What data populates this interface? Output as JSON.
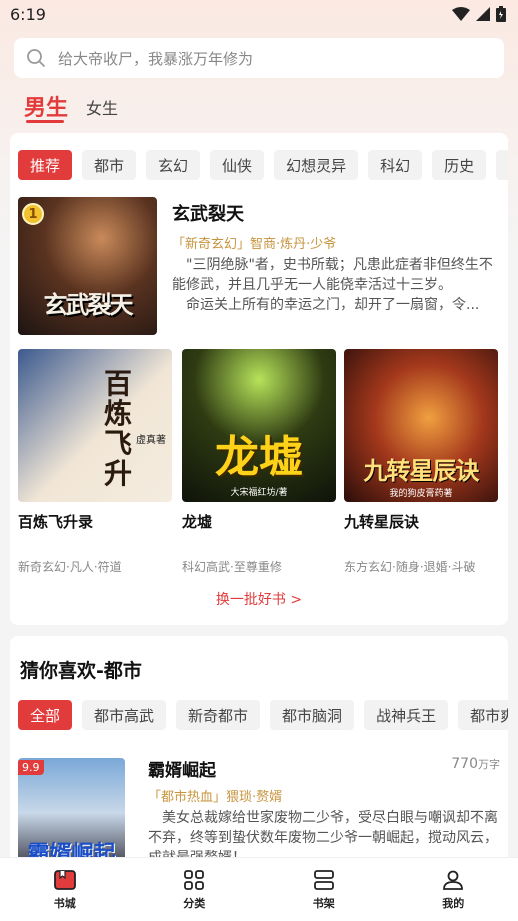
{
  "status_bar": {
    "time": "6:19"
  },
  "search": {
    "placeholder": "给大帝收尸，我暴涨万年修为"
  },
  "gender_tabs": [
    {
      "label": "男生"
    },
    {
      "label": "女生"
    }
  ],
  "categories": [
    "推荐",
    "都市",
    "玄幻",
    "仙侠",
    "幻想灵异",
    "科幻",
    "历史",
    "门"
  ],
  "featured": {
    "rank": "1",
    "title": "玄武裂天",
    "tags": "「新奇玄幻」智商·炼丹·少爷",
    "desc1": "\"三阴绝脉\"者，史书所载；凡患此症者非但终生不能修武，并且几乎无一人能侥幸活过十三岁。",
    "desc2": "命运关上所有的幸运之门，却开了一扇窗，令...",
    "cover_art": "玄武裂天"
  },
  "grid_books": [
    {
      "title": "百炼飞升录",
      "tags": "新奇玄幻·凡人·符道",
      "cover_art": "百炼飞升",
      "cover_author": "虚真著"
    },
    {
      "title": "龙墟",
      "tags": "科幻高武·至尊重修",
      "cover_art": "龙墟",
      "cover_author": "大宋福红坊/著"
    },
    {
      "title": "九转星辰诀",
      "tags": "东方玄幻·随身·退婚·斗破",
      "cover_art": "九转星辰诀",
      "cover_author": "我的狗皮膏药著"
    }
  ],
  "refresh": {
    "label": "换一批好书 >"
  },
  "guess": {
    "title": "猜你喜欢-都市",
    "filters": [
      "全部",
      "都市高武",
      "新奇都市",
      "都市脑洞",
      "战神兵王",
      "都市爽"
    ],
    "item": {
      "score": "9.9",
      "title": "霸婿崛起",
      "count": "770",
      "count_unit": "万字",
      "tags": "「都市热血」猥琐·赘婿",
      "desc": "美女总裁嫁给世家废物二少爷，受尽白眼与嘲讽却不离不弃，终等到蛰伏数年废物二少爷一朝崛起，搅动风云，成就最强赘婿！",
      "cover_art": "霸婿崛起"
    }
  },
  "bottom_nav": [
    {
      "label": "书城"
    },
    {
      "label": "分类"
    },
    {
      "label": "书架"
    },
    {
      "label": "我的"
    }
  ],
  "colors": {
    "accent": "#e23b3b",
    "tag_gold": "#c7943e"
  }
}
